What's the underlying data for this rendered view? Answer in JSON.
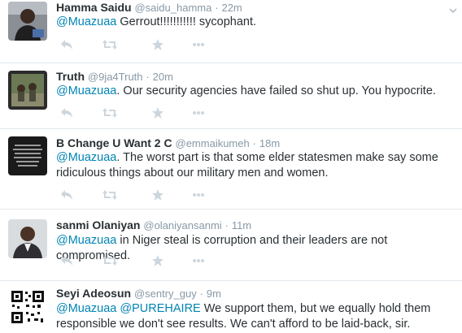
{
  "tweets": [
    {
      "name": "Hamma Saidu",
      "handle": "@saidu_hamma",
      "separator": "·",
      "time": "22m",
      "mention": "@Muazuaa",
      "body": " Gerrout!!!!!!!!!!! sycophant.",
      "avatar_icon": "person-avatar"
    },
    {
      "name": "Truth",
      "handle": "@9ja4Truth",
      "separator": "·",
      "time": "20m",
      "mention": "@Muazuaa",
      "body": ". Our security agencies have failed so shut up. You hypocrite.",
      "avatar_icon": "photo-avatar"
    },
    {
      "name": "B Change U Want 2 C",
      "handle": "@emmaikumeh",
      "separator": "·",
      "time": "18m",
      "mention": "@Muazuaa",
      "body": ". The worst part is that some elder statesmen make say some ridiculous things about our military men and women.",
      "avatar_icon": "text-image-avatar"
    },
    {
      "name": "sanmi Olaniyan",
      "handle": "@olaniyansanmi",
      "separator": "·",
      "time": "11m",
      "mention": "@Muazuaa",
      "body": " in Niger steal is corruption and their leaders are not compromised.",
      "avatar_icon": "person-avatar"
    },
    {
      "name": "Seyi Adeosun",
      "handle": "@sentry_guy",
      "separator": "·",
      "time": "9m",
      "mention": "@Muazuaa",
      "mention2": "@PUREHAIRE",
      "body": " We support them, but we equally hold them responsible we don't see results. We can't afford to be laid-back, sir.",
      "avatar_icon": "qr-code-avatar"
    }
  ],
  "colors": {
    "link": "#0084b4",
    "meta": "#8899a6",
    "action_icon": "#ccd6dd",
    "divider": "#e1e8ed"
  },
  "action_icons": [
    "reply-icon",
    "retweet-icon",
    "favorite-icon",
    "more-icon"
  ]
}
